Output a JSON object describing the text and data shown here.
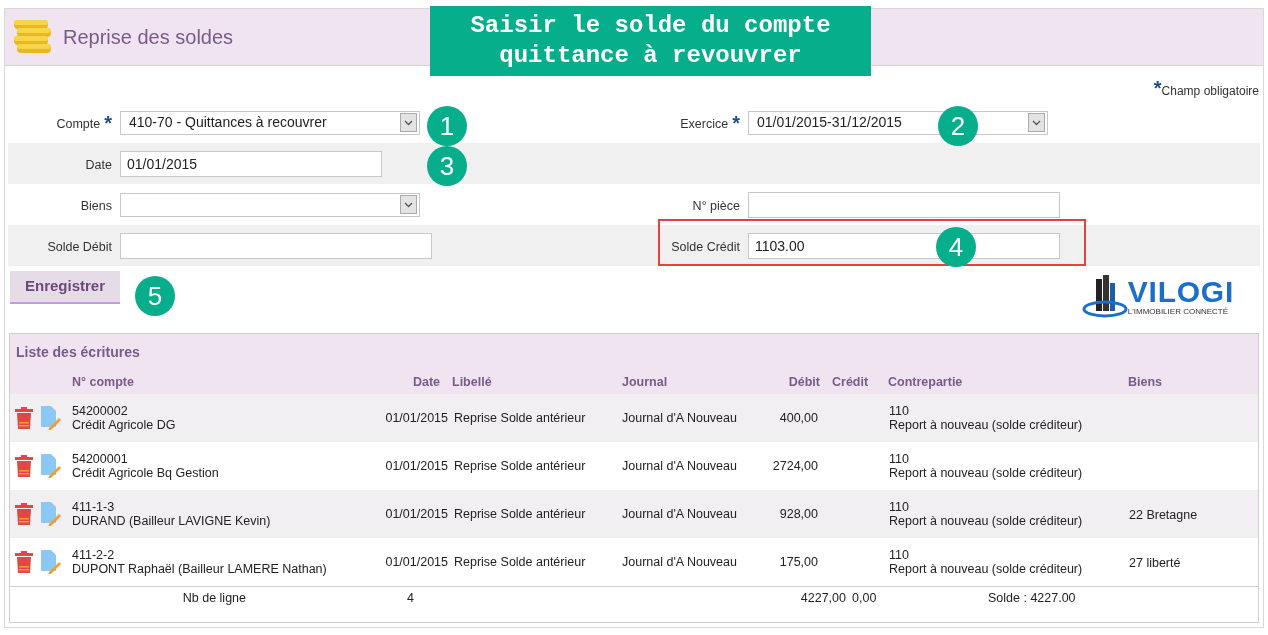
{
  "header": {
    "title": "Reprise des soldes"
  },
  "annotation": {
    "banner": [
      "Saisir le solde du compte",
      "quittance à revouvrer"
    ],
    "badges": [
      "1",
      "2",
      "3",
      "4",
      "5"
    ]
  },
  "form": {
    "required_mark": "*",
    "required_note": "Champ obligatoire",
    "rows": [
      {
        "left": {
          "label": "Compte",
          "kind": "select",
          "value": "410-70 - Quittances à recouvrer",
          "required": true
        },
        "right": {
          "label": "Exercice",
          "kind": "select",
          "value": "01/01/2015-31/12/2015",
          "required": true
        }
      },
      {
        "left": {
          "label": "Date",
          "kind": "text",
          "value": "01/01/2015",
          "required": false
        }
      },
      {
        "left": {
          "label": "Biens",
          "kind": "select",
          "required": false
        },
        "right": {
          "label": "N° pièce",
          "kind": "text",
          "required": false
        }
      },
      {
        "left": {
          "label": "Solde Débit",
          "kind": "text",
          "required": false
        },
        "right": {
          "label": "Solde Crédit",
          "kind": "text",
          "value": "1103.00",
          "required": false
        }
      }
    ],
    "save_button": "Enregistrer"
  },
  "logo": {
    "name": "VILOGI",
    "tagline": "L'IMMOBILIER CONNECTÉ"
  },
  "table": {
    "title": "Liste des écritures",
    "columns": [
      "N° compte",
      "Date",
      "Libellé",
      "Journal",
      "Débit",
      "Crédit",
      "Contrepartie",
      "Biens"
    ],
    "rows": [
      {
        "account_number": "54200002",
        "account_name": "Crédit Agricole DG",
        "date": "01/01/2015",
        "label": "Reprise Solde antérieur",
        "journal": "Journal d'A Nouveau",
        "debit": "400,00",
        "counterpart_code": "110",
        "counterpart_label": "Report à nouveau (solde créditeur)"
      },
      {
        "account_number": "54200001",
        "account_name": "Crédit Agricole Bq Gestion",
        "date": "01/01/2015",
        "label": "Reprise Solde antérieur",
        "journal": "Journal d'A Nouveau",
        "debit": "2724,00",
        "counterpart_code": "110",
        "counterpart_label": "Report à nouveau (solde créditeur)"
      },
      {
        "account_number": "411-1-3",
        "account_name": "DURAND (Bailleur LAVIGNE Kevin)",
        "date": "01/01/2015",
        "label": "Reprise Solde antérieur",
        "journal": "Journal d'A Nouveau",
        "debit": "928,00",
        "counterpart_code": "110",
        "counterpart_label": "Report à nouveau (solde créditeur)",
        "property": "22 Bretagne"
      },
      {
        "account_number": "411-2-2",
        "account_name": "DUPONT Raphaël (Bailleur LAMERE Nathan)",
        "date": "01/01/2015",
        "label": "Reprise Solde antérieur",
        "journal": "Journal d'A Nouveau",
        "debit": "175,00",
        "counterpart_code": "110",
        "counterpart_label": "Report à nouveau (solde créditeur)",
        "property": "27 liberté"
      }
    ],
    "footer": {
      "label": "Nb de ligne",
      "count": "4",
      "debit_total": "4227,00",
      "credit_total": "0,00",
      "balance": "Solde : 4227.00"
    }
  }
}
